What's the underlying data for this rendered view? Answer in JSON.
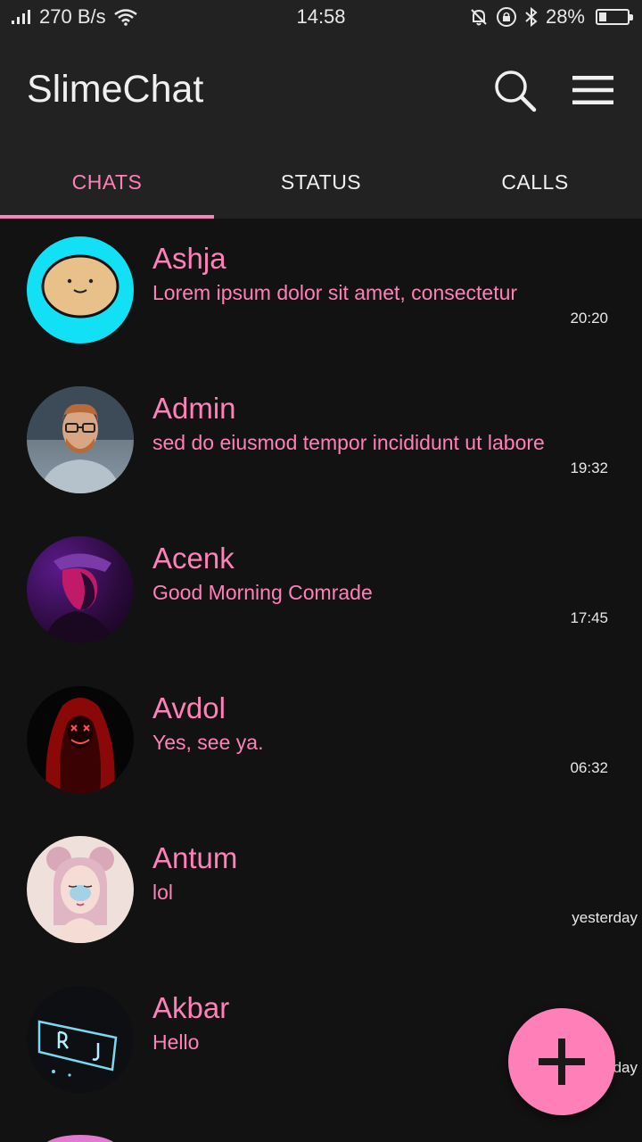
{
  "status_bar": {
    "net_speed": "270 B/s",
    "time": "14:58",
    "battery": "28%",
    "battery_level": 0.28
  },
  "app": {
    "title": "SlimeChat",
    "accent": "#ff80b8",
    "background": "#121212",
    "bar_color": "#222222"
  },
  "actions": {
    "search_icon": "search-icon",
    "menu_icon": "menu-icon"
  },
  "tabs": [
    {
      "label": "CHATS",
      "active": true
    },
    {
      "label": "STATUS",
      "active": false
    },
    {
      "label": "CALLS",
      "active": false
    }
  ],
  "chats": [
    {
      "name": "Ashja",
      "message": "Lorem ipsum dolor sit amet, consectetur",
      "time": "20:20"
    },
    {
      "name": "Admin",
      "message": "sed do eiusmod tempor incididunt ut labore",
      "time": "19:32"
    },
    {
      "name": "Acenk",
      "message": "Good Morning Comrade",
      "time": "17:45"
    },
    {
      "name": "Avdol",
      "message": "Yes, see ya.",
      "time": "06:32"
    },
    {
      "name": "Antum",
      "message": "lol",
      "time": "yesterday"
    },
    {
      "name": "Akbar",
      "message": "Hello",
      "time": "yesterday"
    }
  ],
  "fab": {
    "icon": "plus-icon"
  }
}
